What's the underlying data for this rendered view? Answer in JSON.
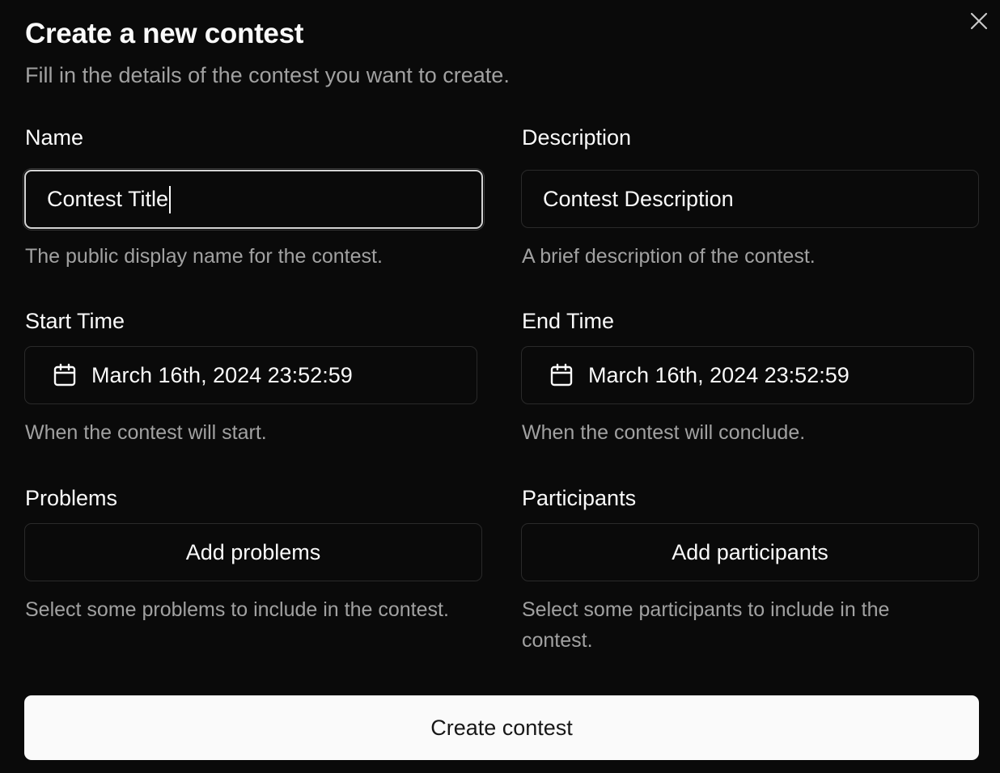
{
  "dialog": {
    "title": "Create a new contest",
    "subtitle": "Fill in the details of the contest you want to create.",
    "close_icon": "close-icon"
  },
  "fields": {
    "name": {
      "label": "Name",
      "value": "Contest Title",
      "help": "The public display name for the contest."
    },
    "description": {
      "label": "Description",
      "value": "Contest Description",
      "help": "A brief description of the contest."
    },
    "start_time": {
      "label": "Start Time",
      "value": "March 16th, 2024 23:52:59",
      "help": "When the contest will start.",
      "icon": "calendar-icon"
    },
    "end_time": {
      "label": "End Time",
      "value": "March 16th, 2024 23:52:59",
      "help": "When the contest will conclude.",
      "icon": "calendar-icon"
    },
    "problems": {
      "label": "Problems",
      "button": "Add problems",
      "help": "Select some problems to include in the contest."
    },
    "participants": {
      "label": "Participants",
      "button": "Add participants",
      "help": "Select some participants to include in the contest."
    }
  },
  "submit": {
    "label": "Create contest"
  },
  "colors": {
    "background": "#0a0a0a",
    "foreground": "#fafafa",
    "muted": "#a1a1a1",
    "border": "#2a2a2a",
    "primary_button": "#fafafa"
  }
}
